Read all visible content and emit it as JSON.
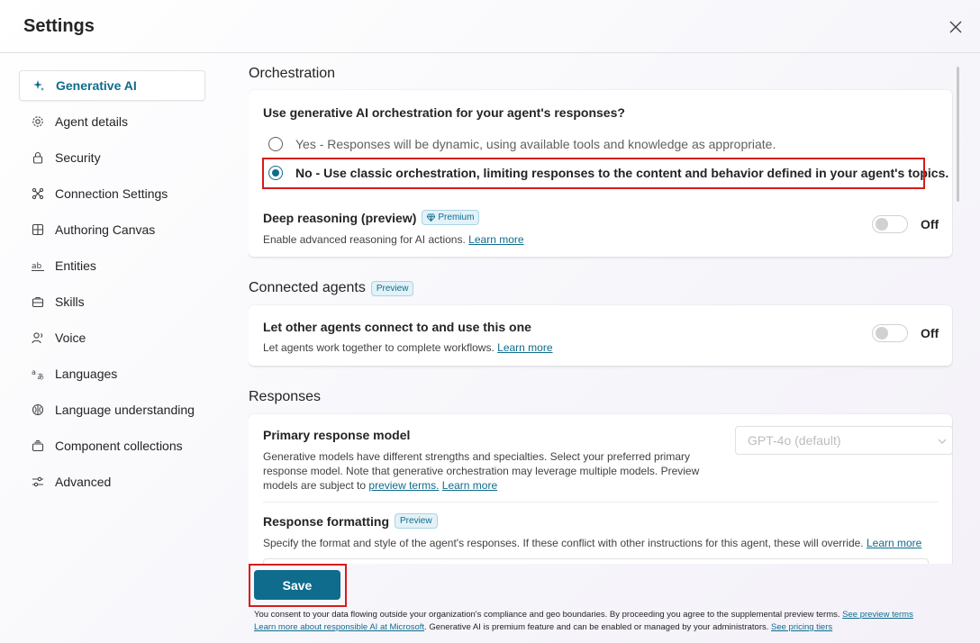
{
  "header": {
    "title": "Settings"
  },
  "sidebar": {
    "items": [
      {
        "label": "Generative AI",
        "icon": "sparkle-icon",
        "active": true
      },
      {
        "label": "Agent details",
        "icon": "gear-icon"
      },
      {
        "label": "Security",
        "icon": "lock-icon"
      },
      {
        "label": "Connection Settings",
        "icon": "connection-icon"
      },
      {
        "label": "Authoring Canvas",
        "icon": "grid-icon"
      },
      {
        "label": "Entities",
        "icon": "text-ab-icon"
      },
      {
        "label": "Skills",
        "icon": "briefcase-icon"
      },
      {
        "label": "Voice",
        "icon": "person-voice-icon"
      },
      {
        "label": "Languages",
        "icon": "translate-icon"
      },
      {
        "label": "Language understanding",
        "icon": "brain-icon"
      },
      {
        "label": "Component collections",
        "icon": "collection-icon"
      },
      {
        "label": "Advanced",
        "icon": "sliders-icon"
      }
    ]
  },
  "orchestration": {
    "title": "Orchestration",
    "question": "Use generative AI orchestration for your agent's responses?",
    "options": [
      {
        "label": "Yes - Responses will be dynamic, using available tools and knowledge as appropriate.",
        "checked": false
      },
      {
        "label": "No - Use classic orchestration, limiting responses to the content and behavior defined in your agent's topics.",
        "checked": true
      }
    ],
    "deep_reasoning": {
      "title": "Deep reasoning (preview)",
      "badge": "Premium",
      "desc": "Enable advanced reasoning for AI actions.",
      "link": "Learn more",
      "toggle": "Off"
    }
  },
  "connected_agents": {
    "title": "Connected agents",
    "badge": "Preview",
    "question": "Let other agents connect to and use this one",
    "desc": "Let agents work together to complete workflows.",
    "link": "Learn more",
    "toggle": "Off"
  },
  "responses": {
    "title": "Responses",
    "primary_model": {
      "title": "Primary response model",
      "desc_1": "Generative models have different strengths and specialties. Select your preferred primary",
      "desc_2": "response model. Note that generative orchestration may leverage multiple models. Preview",
      "desc_3": "models are subject to",
      "link_terms": "preview terms.",
      "link_more": "Learn more",
      "selected": "GPT-4o (default)"
    },
    "formatting": {
      "title": "Response formatting",
      "badge": "Preview",
      "desc": "Specify the format and style of the agent's responses. If these conflict with other instructions for this agent, these will override.",
      "link": "Learn more"
    }
  },
  "footer": {
    "save_label": "Save",
    "consent_1": "You consent to your data flowing outside your organization's compliance and geo boundaries. By proceeding you agree to the supplemental preview terms.",
    "consent_link_1": "See preview terms",
    "consent_link_2": "Learn more about responsible AI at Microsoft",
    "consent_2": ". Generative AI is premium feature and can be enabled or managed by your administrators.",
    "consent_link_3": "See pricing tiers"
  },
  "colors": {
    "accent": "#0f6c8d",
    "highlight": "#d81b1b"
  }
}
